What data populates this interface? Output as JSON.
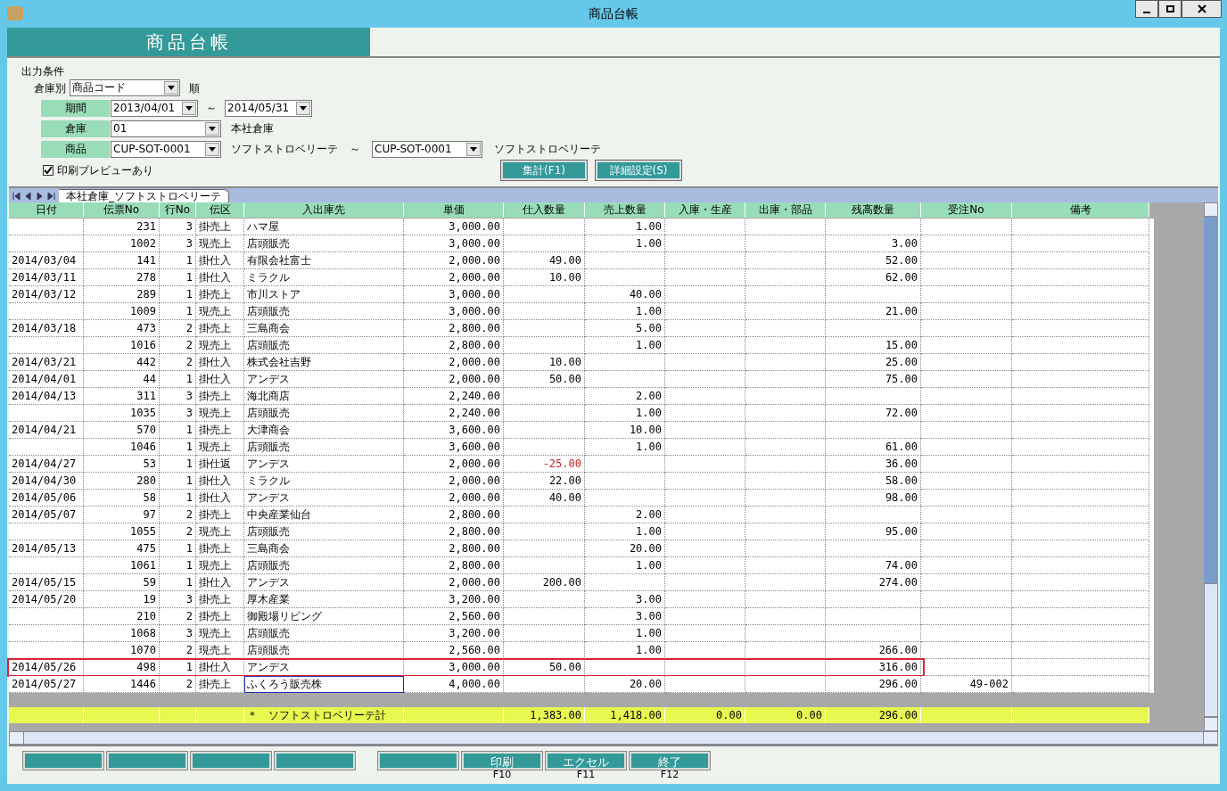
{
  "window": {
    "title": "商品台帳"
  },
  "header": {
    "title": "商品台帳"
  },
  "conditions": {
    "title": "出力条件",
    "sort_label": "倉庫別",
    "sort_value": "商品コード",
    "sort_suffix": "順",
    "period": {
      "label": "期間",
      "from": "2013/04/01",
      "separator": "～",
      "to": "2014/05/31"
    },
    "warehouse": {
      "label": "倉庫",
      "value": "01",
      "name": "本社倉庫"
    },
    "product": {
      "label": "商品",
      "from": "CUP-SOT-0001",
      "from_name": "ソフトストロベリーテ",
      "separator": "～",
      "to": "CUP-SOT-0001",
      "to_name": "ソフトストロベリーテ"
    },
    "preview": {
      "label": "印刷プレビューあり",
      "checked": true
    },
    "buttons": [
      "集計(F1)",
      "詳細設定(S)"
    ]
  },
  "sheet_tab": "本社倉庫_ソフトストロベリーテ",
  "table": {
    "columns": [
      "日付",
      "伝票No",
      "行No",
      "伝区",
      "入出庫先",
      "単価",
      "仕入数量",
      "売上数量",
      "入庫・生産",
      "出庫・部品",
      "残高数量",
      "受注No",
      "備考"
    ],
    "rows": [
      {
        "slip": "231",
        "line": "3",
        "type": "掛売上",
        "partner": "ハマ屋",
        "price": "3,000.00",
        "sales": "1.00",
        "highlighted": false,
        "focused": false
      },
      {
        "slip": "1002",
        "line": "3",
        "type": "現売上",
        "partner": "店頭販売",
        "price": "3,000.00",
        "sales": "1.00",
        "balance": "3.00",
        "highlighted": false,
        "focused": false
      },
      {
        "date": "2014/03/04",
        "slip": "141",
        "line": "1",
        "type": "掛仕入",
        "partner": "有限会社富士",
        "price": "2,000.00",
        "purchase": "49.00",
        "balance": "52.00",
        "negative": false,
        "highlighted": false,
        "focused": false
      },
      {
        "date": "2014/03/11",
        "slip": "278",
        "line": "1",
        "type": "掛仕入",
        "partner": "ミラクル",
        "price": "2,000.00",
        "purchase": "10.00",
        "balance": "62.00",
        "negative": false,
        "highlighted": false,
        "focused": false
      },
      {
        "date": "2014/03/12",
        "slip": "289",
        "line": "1",
        "type": "掛売上",
        "partner": "市川ストア",
        "price": "3,000.00",
        "sales": "40.00",
        "highlighted": false,
        "focused": false
      },
      {
        "slip": "1009",
        "line": "1",
        "type": "現売上",
        "partner": "店頭販売",
        "price": "3,000.00",
        "sales": "1.00",
        "balance": "21.00",
        "highlighted": false,
        "focused": false
      },
      {
        "date": "2014/03/18",
        "slip": "473",
        "line": "2",
        "type": "掛売上",
        "partner": "三島商会",
        "price": "2,800.00",
        "sales": "5.00",
        "highlighted": false,
        "focused": false
      },
      {
        "slip": "1016",
        "line": "2",
        "type": "現売上",
        "partner": "店頭販売",
        "price": "2,800.00",
        "sales": "1.00",
        "balance": "15.00",
        "highlighted": false,
        "focused": false
      },
      {
        "date": "2014/03/21",
        "slip": "442",
        "line": "2",
        "type": "掛仕入",
        "partner": "株式会社吉野",
        "price": "2,000.00",
        "purchase": "10.00",
        "balance": "25.00",
        "negative": false,
        "highlighted": false,
        "focused": false
      },
      {
        "date": "2014/04/01",
        "slip": "44",
        "line": "1",
        "type": "掛仕入",
        "partner": "アンデス",
        "price": "2,000.00",
        "purchase": "50.00",
        "balance": "75.00",
        "negative": false,
        "highlighted": false,
        "focused": false
      },
      {
        "date": "2014/04/13",
        "slip": "311",
        "line": "3",
        "type": "掛売上",
        "partner": "海北商店",
        "price": "2,240.00",
        "sales": "2.00",
        "highlighted": false,
        "focused": false
      },
      {
        "slip": "1035",
        "line": "3",
        "type": "現売上",
        "partner": "店頭販売",
        "price": "2,240.00",
        "sales": "1.00",
        "balance": "72.00",
        "highlighted": false,
        "focused": false
      },
      {
        "date": "2014/04/21",
        "slip": "570",
        "line": "1",
        "type": "掛売上",
        "partner": "大津商会",
        "price": "3,600.00",
        "sales": "10.00",
        "highlighted": false,
        "focused": false
      },
      {
        "slip": "1046",
        "line": "1",
        "type": "現売上",
        "partner": "店頭販売",
        "price": "3,600.00",
        "sales": "1.00",
        "balance": "61.00",
        "highlighted": false,
        "focused": false
      },
      {
        "date": "2014/04/27",
        "slip": "53",
        "line": "1",
        "type": "掛仕返",
        "partner": "アンデス",
        "price": "2,000.00",
        "purchase": "-25.00",
        "balance": "36.00",
        "negative": true,
        "highlighted": false,
        "focused": false
      },
      {
        "date": "2014/04/30",
        "slip": "280",
        "line": "1",
        "type": "掛仕入",
        "partner": "ミラクル",
        "price": "2,000.00",
        "purchase": "22.00",
        "balance": "58.00",
        "negative": false,
        "highlighted": false,
        "focused": false
      },
      {
        "date": "2014/05/06",
        "slip": "58",
        "line": "1",
        "type": "掛仕入",
        "partner": "アンデス",
        "price": "2,000.00",
        "purchase": "40.00",
        "balance": "98.00",
        "negative": false,
        "highlighted": false,
        "focused": false
      },
      {
        "date": "2014/05/07",
        "slip": "97",
        "line": "2",
        "type": "掛売上",
        "partner": "中央産業仙台",
        "price": "2,800.00",
        "sales": "2.00",
        "highlighted": false,
        "focused": false
      },
      {
        "slip": "1055",
        "line": "2",
        "type": "現売上",
        "partner": "店頭販売",
        "price": "2,800.00",
        "sales": "1.00",
        "balance": "95.00",
        "highlighted": false,
        "focused": false
      },
      {
        "date": "2014/05/13",
        "slip": "475",
        "line": "1",
        "type": "掛売上",
        "partner": "三島商会",
        "price": "2,800.00",
        "sales": "20.00",
        "highlighted": false,
        "focused": false
      },
      {
        "slip": "1061",
        "line": "1",
        "type": "現売上",
        "partner": "店頭販売",
        "price": "2,800.00",
        "sales": "1.00",
        "balance": "74.00",
        "highlighted": false,
        "focused": false
      },
      {
        "date": "2014/05/15",
        "slip": "59",
        "line": "1",
        "type": "掛仕入",
        "partner": "アンデス",
        "price": "2,000.00",
        "purchase": "200.00",
        "balance": "274.00",
        "negative": false,
        "highlighted": false,
        "focused": false
      },
      {
        "date": "2014/05/20",
        "slip": "19",
        "line": "3",
        "type": "掛売上",
        "partner": "厚木産業",
        "price": "3,200.00",
        "sales": "3.00",
        "highlighted": false,
        "focused": false
      },
      {
        "slip": "210",
        "line": "2",
        "type": "掛売上",
        "partner": "御殿場リビング",
        "price": "2,560.00",
        "sales": "3.00",
        "highlighted": false,
        "focused": false
      },
      {
        "slip": "1068",
        "line": "3",
        "type": "現売上",
        "partner": "店頭販売",
        "price": "3,200.00",
        "sales": "1.00",
        "highlighted": false,
        "focused": false
      },
      {
        "slip": "1070",
        "line": "2",
        "type": "現売上",
        "partner": "店頭販売",
        "price": "2,560.00",
        "sales": "1.00",
        "balance": "266.00",
        "highlighted": false,
        "focused": false
      },
      {
        "date": "2014/05/26",
        "slip": "498",
        "line": "1",
        "type": "掛仕入",
        "partner": "アンデス",
        "price": "3,000.00",
        "purchase": "50.00",
        "balance": "316.00",
        "negative": false,
        "highlighted": true,
        "focused": false
      },
      {
        "date": "2014/05/27",
        "slip": "1446",
        "line": "2",
        "type": "掛売上",
        "partner": "ふくろう販売株",
        "price": "4,000.00",
        "sales": "20.00",
        "balance": "296.00",
        "order": "49-002",
        "highlighted": false,
        "focused": true
      }
    ],
    "total": {
      "partner": "＊　ソフトストロベリーテ計",
      "purchase": "1,383.00",
      "sales": "1,418.00",
      "in": "0.00",
      "out": "0.00",
      "balance": "296.00"
    }
  },
  "function_keys": [
    {
      "kind": "blank"
    },
    {
      "kind": "blank"
    },
    {
      "kind": "blank"
    },
    {
      "kind": "blank"
    },
    {
      "kind": "blank"
    },
    {
      "kind": "labeled",
      "label": "印刷",
      "key": "F10"
    },
    {
      "kind": "labeled",
      "label": "エクセル",
      "key": "F11"
    },
    {
      "kind": "labeled",
      "label": "終了",
      "key": "F12"
    }
  ]
}
